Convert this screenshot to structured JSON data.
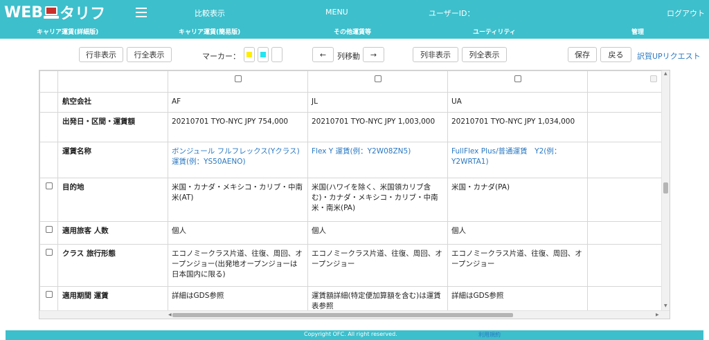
{
  "header": {
    "logo_left": "WEB",
    "logo_right": "タリフ",
    "compare": "比較表示",
    "menu": "MENU",
    "user_id_label": "ユーザーID：",
    "logout": "ログアウト",
    "sub_nav": [
      "キャリア運賃(詳細版)",
      "キャリア運賃(簡易版)",
      "その他運賃等",
      "ユーティリティ",
      "管理"
    ]
  },
  "toolbar": {
    "row_hide": "行非表示",
    "row_show_all": "行全表示",
    "marker_label": "マーカー：",
    "markers": [
      "#ffee00",
      "#22e6f2",
      "#ffffff"
    ],
    "move_left": "←",
    "col_move": "列移動",
    "move_right": "→",
    "col_hide": "列非表示",
    "col_show_all": "列全表示",
    "save": "保存",
    "back": "戻る",
    "request_link": "訳賀UPリクエスト"
  },
  "grid": {
    "rows": [
      {
        "label": "航空会社",
        "values": [
          "AF",
          "JL",
          "UA",
          ""
        ]
      },
      {
        "label": "出発日・区間・運賃額",
        "values": [
          "20210701 TYO-NYC JPY 754,000",
          "20210701 TYO-NYC JPY 1,003,000",
          "20210701 TYO-NYC JPY 1,034,000",
          ""
        ]
      },
      {
        "label": "運賃名称",
        "values": [
          "ボンジュール フルフレックス(Yクラス)運賃(例：YS50AENO)",
          "Flex Y 運賃(例：Y2W08ZN5)",
          "FullFlex Plus/普通運賃　Y2(例：Y2WRTA1)",
          ""
        ]
      },
      {
        "label": "目的地",
        "values": [
          "米国・カナダ・メキシコ・カリブ・中南米(AT)",
          "米国(ハワイを除く、米国領カリブ含む)・カナダ・メキシコ・カリブ・中南米・南米(PA)",
          "米国・カナダ(PA)",
          ""
        ]
      },
      {
        "label": "適用旅客 人数",
        "values": [
          "個人",
          "個人",
          "個人",
          ""
        ]
      },
      {
        "label": "クラス 旅行形態",
        "values": [
          "エコノミークラス片道、往復、周回、オープンジョー(出発地オープンジョーは日本国内に限る)",
          "エコノミークラス片道、往復、周回、オープンジョー",
          "エコノミークラス片道、往復、周回、オープンジョー",
          ""
        ]
      },
      {
        "label": "適用期間 運賃",
        "values": [
          "詳細はGDS参照",
          "運賃額詳細(特定便加算額を含む)は運賃表参照",
          "詳細はGDS参照",
          ""
        ]
      }
    ]
  },
  "footer": {
    "copyright": "Copyright OFC. All right reserved.",
    "terms": "利用規約"
  },
  "colors": {
    "brand": "#3dbfcc",
    "link": "#2a78c2",
    "logo_screen": "#c9302c"
  }
}
